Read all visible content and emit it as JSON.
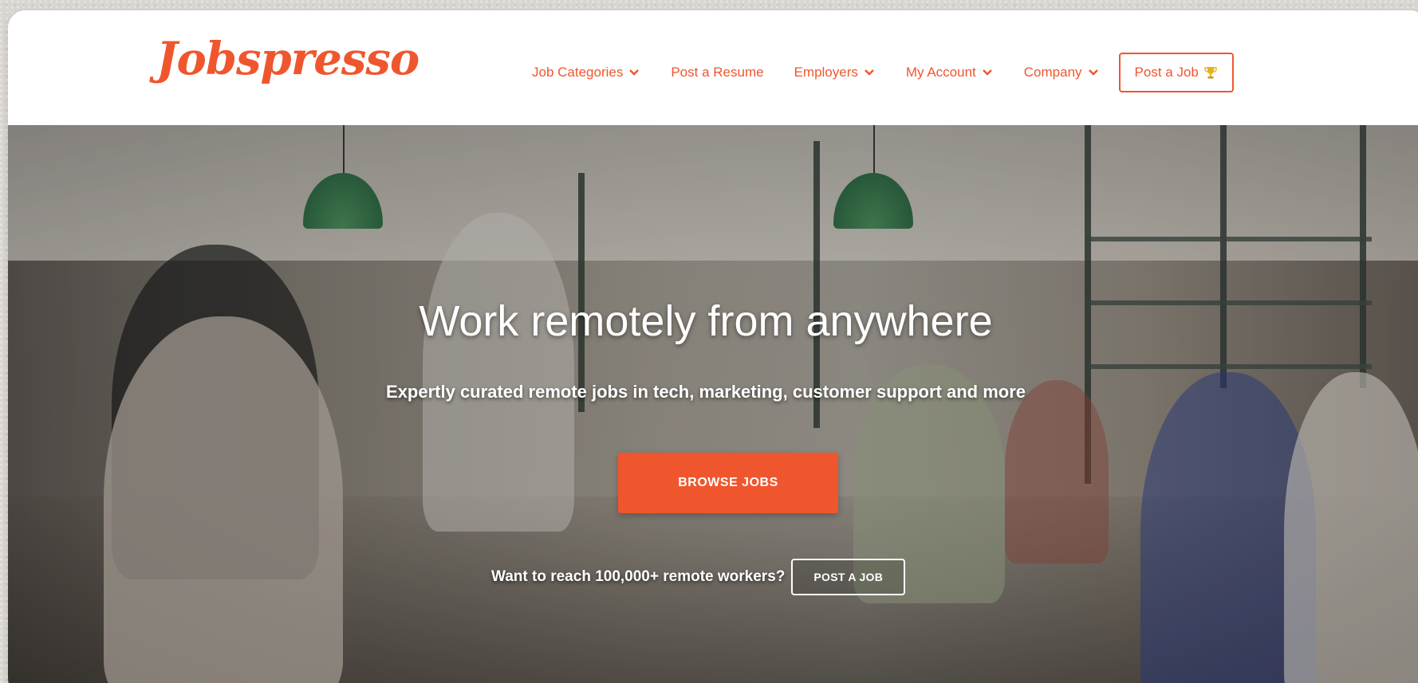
{
  "header": {
    "logo": "Jobspresso",
    "nav": [
      {
        "label": "Job Categories",
        "has_dropdown": true
      },
      {
        "label": "Post a Resume",
        "has_dropdown": false
      },
      {
        "label": "Employers",
        "has_dropdown": true
      },
      {
        "label": "My Account",
        "has_dropdown": true
      },
      {
        "label": "Company",
        "has_dropdown": true
      }
    ],
    "post_job_label": "Post a Job",
    "post_job_icon": "trophy-icon"
  },
  "hero": {
    "title": "Work remotely from anywhere",
    "subtitle": "Expertly curated remote jobs in tech, marketing, customer support and more",
    "browse_label": "BROWSE JOBS",
    "reach_text": "Want to reach 100,000+ remote workers?",
    "post_job_label": "POST A JOB"
  },
  "colors": {
    "accent": "#f0562d",
    "white": "#ffffff"
  }
}
